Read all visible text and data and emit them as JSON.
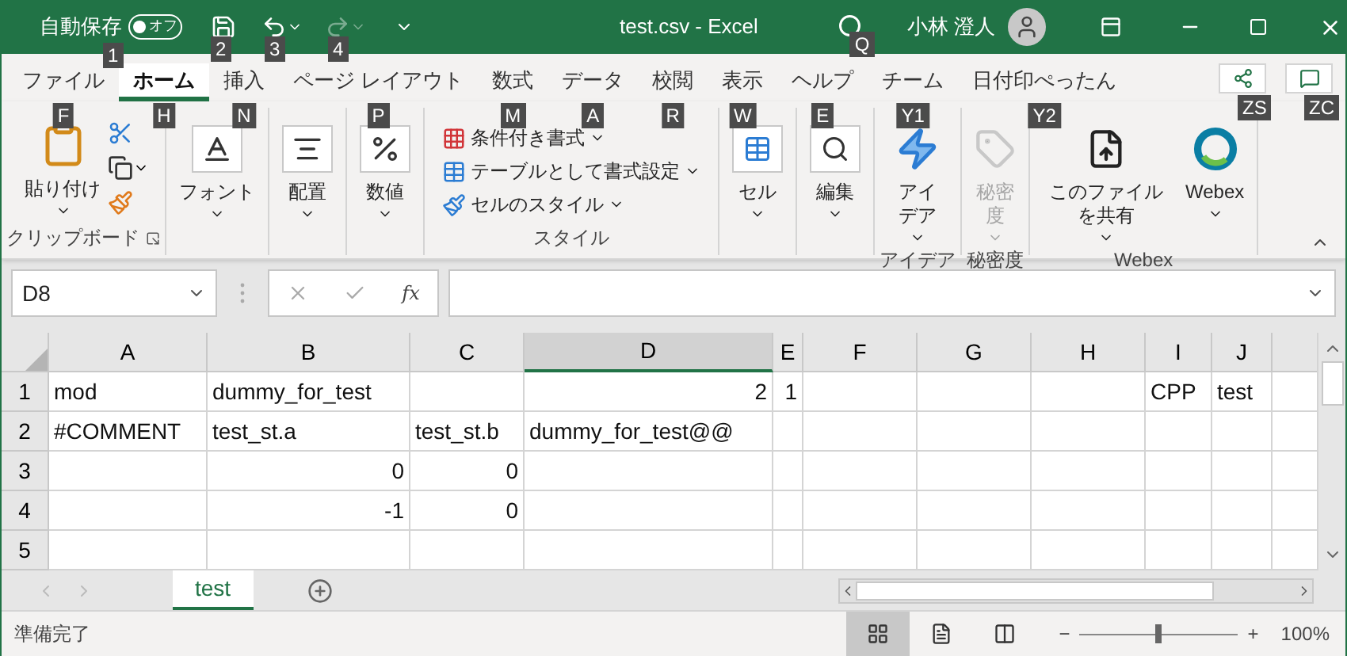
{
  "title_bar": {
    "autosave_label": "自動保存",
    "autosave_toggle": {
      "label": "オフ",
      "on": false
    },
    "keytips": [
      "1",
      "2",
      "3",
      "4"
    ],
    "redo_disabled": true,
    "title": "test.csv - Excel",
    "search_keytip": "Q",
    "user": "小林 澄人"
  },
  "tabs": [
    {
      "label": "ファイル",
      "keytip": "F",
      "selected": false
    },
    {
      "label": "ホーム",
      "keytip": "H",
      "selected": true
    },
    {
      "label": "挿入",
      "keytip": "N",
      "selected": false
    },
    {
      "label": "ページ レイアウト",
      "keytip": "P",
      "selected": false
    },
    {
      "label": "数式",
      "keytip": "M",
      "selected": false
    },
    {
      "label": "データ",
      "keytip": "A",
      "selected": false
    },
    {
      "label": "校閲",
      "keytip": "R",
      "selected": false
    },
    {
      "label": "表示",
      "keytip": "W",
      "selected": false
    },
    {
      "label": "ヘルプ",
      "keytip": "E",
      "selected": false
    },
    {
      "label": "チーム",
      "keytip": "Y1",
      "selected": false
    },
    {
      "label": "日付印ぺったん",
      "keytip": "Y2",
      "selected": false
    }
  ],
  "tab_bar_buttons": [
    {
      "kind": "share",
      "keytip": "ZS"
    },
    {
      "kind": "comments",
      "keytip": "ZC"
    }
  ],
  "ribbon": {
    "groups": [
      {
        "kind": "clipboard",
        "label": "クリップボード",
        "buttons": [
          {
            "kind": "paste",
            "label": "貼り付け",
            "disabled": false
          }
        ]
      },
      {
        "kind": "large",
        "buttons": [
          {
            "kind": "font",
            "label": "フォント",
            "disabled": false
          }
        ]
      },
      {
        "kind": "large",
        "buttons": [
          {
            "kind": "align",
            "label": "配置",
            "disabled": false
          }
        ]
      },
      {
        "kind": "large",
        "buttons": [
          {
            "kind": "number",
            "label": "数値",
            "disabled": false
          }
        ]
      },
      {
        "kind": "list",
        "label": "スタイル",
        "buttons": [
          {
            "kind": "conditional",
            "label": "条件付き書式",
            "disabled": false
          },
          {
            "kind": "table",
            "label": "テーブルとして書式設定",
            "disabled": false
          },
          {
            "kind": "cellstyle",
            "label": "セルのスタイル",
            "disabled": false
          }
        ]
      },
      {
        "kind": "large",
        "buttons": [
          {
            "kind": "cells",
            "label": "セル",
            "disabled": false
          }
        ]
      },
      {
        "kind": "large",
        "buttons": [
          {
            "kind": "edit",
            "label": "編集",
            "disabled": false
          }
        ]
      },
      {
        "kind": "large",
        "label": "アイデア",
        "buttons": [
          {
            "kind": "ideas",
            "label": "アイデア",
            "disabled": false
          }
        ]
      },
      {
        "kind": "large",
        "label": "秘密度",
        "buttons": [
          {
            "kind": "sensitivity",
            "label": "秘密度",
            "disabled": true
          }
        ]
      },
      {
        "kind": "large",
        "label": "Webex",
        "buttons": [
          {
            "kind": "sharefile",
            "label": "このファイルを共有",
            "disabled": false
          },
          {
            "kind": "webex",
            "label": "Webex",
            "disabled": false
          }
        ]
      }
    ]
  },
  "formula_bar": {
    "name_box": "D8",
    "fx": "fx"
  },
  "sheet": {
    "columns": [
      {
        "label": "A",
        "selected": false
      },
      {
        "label": "B",
        "selected": false
      },
      {
        "label": "C",
        "selected": false
      },
      {
        "label": "D",
        "selected": true
      },
      {
        "label": "E",
        "selected": false
      },
      {
        "label": "F",
        "selected": false
      },
      {
        "label": "G",
        "selected": false
      },
      {
        "label": "H",
        "selected": false
      },
      {
        "label": "I",
        "selected": false
      },
      {
        "label": "J",
        "selected": false
      }
    ],
    "rows": [
      {
        "header": "1",
        "cells": [
          {
            "kind": "text",
            "value": "mod"
          },
          {
            "kind": "text",
            "value": "dummy_for_test"
          },
          {
            "kind": "empty"
          },
          {
            "kind": "number",
            "value": "2"
          },
          {
            "kind": "number",
            "value": "1"
          },
          {
            "kind": "empty"
          },
          {
            "kind": "empty"
          },
          {
            "kind": "empty"
          },
          {
            "kind": "text",
            "value": "CPP"
          },
          {
            "kind": "text",
            "value": "test"
          }
        ]
      },
      {
        "header": "2",
        "cells": [
          {
            "kind": "text",
            "value": "#COMMENT"
          },
          {
            "kind": "text",
            "value": "test_st.a"
          },
          {
            "kind": "text",
            "value": "test_st.b"
          },
          {
            "kind": "text",
            "value": "dummy_for_test@@"
          },
          {
            "kind": "empty"
          },
          {
            "kind": "empty"
          },
          {
            "kind": "empty"
          },
          {
            "kind": "empty"
          },
          {
            "kind": "empty"
          },
          {
            "kind": "empty"
          }
        ]
      },
      {
        "header": "3",
        "cells": [
          {
            "kind": "empty"
          },
          {
            "kind": "number",
            "value": "0"
          },
          {
            "kind": "number",
            "value": "0"
          },
          {
            "kind": "empty"
          },
          {
            "kind": "empty"
          },
          {
            "kind": "empty"
          },
          {
            "kind": "empty"
          },
          {
            "kind": "empty"
          },
          {
            "kind": "empty"
          },
          {
            "kind": "empty"
          }
        ]
      },
      {
        "header": "4",
        "cells": [
          {
            "kind": "empty"
          },
          {
            "kind": "number",
            "value": "-1"
          },
          {
            "kind": "number",
            "value": "0"
          },
          {
            "kind": "empty"
          },
          {
            "kind": "empty"
          },
          {
            "kind": "empty"
          },
          {
            "kind": "empty"
          },
          {
            "kind": "empty"
          },
          {
            "kind": "empty"
          },
          {
            "kind": "empty"
          }
        ]
      },
      {
        "header": "5",
        "cells": [
          {
            "kind": "empty"
          },
          {
            "kind": "empty"
          },
          {
            "kind": "empty"
          },
          {
            "kind": "empty"
          },
          {
            "kind": "empty"
          },
          {
            "kind": "empty"
          },
          {
            "kind": "empty"
          },
          {
            "kind": "empty"
          },
          {
            "kind": "empty"
          },
          {
            "kind": "empty"
          }
        ]
      }
    ]
  },
  "sheet_tabs": [
    {
      "label": "test",
      "selected": true
    }
  ],
  "status_bar": {
    "status": "準備完了",
    "views": [
      {
        "kind": "normal",
        "selected": true
      },
      {
        "kind": "layout",
        "selected": false
      },
      {
        "kind": "pagebreak",
        "selected": false
      }
    ],
    "zoom": {
      "minus": "−",
      "plus": "+",
      "level": 0.5,
      "reading": "100%"
    }
  }
}
